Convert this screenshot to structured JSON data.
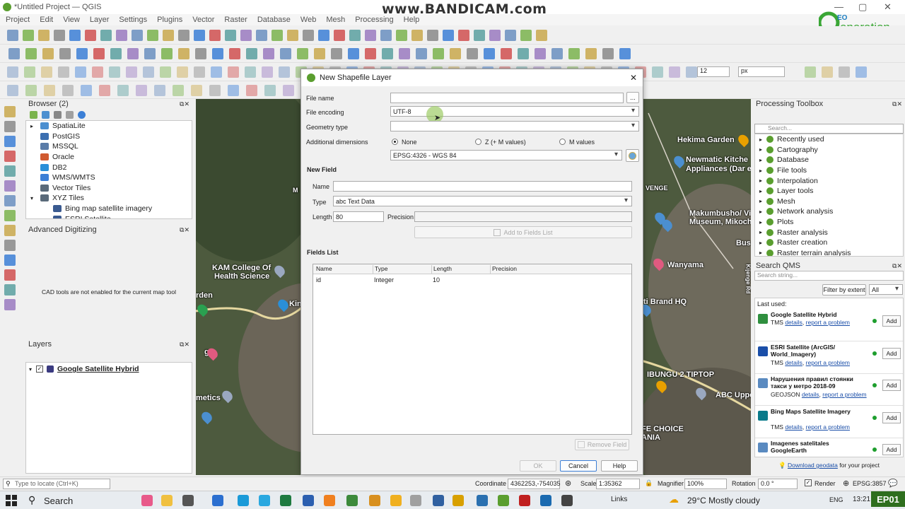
{
  "window": {
    "title": "*Untitled Project — QGIS",
    "watermark": "www.BANDICAM.com"
  },
  "menu": [
    "Project",
    "Edit",
    "View",
    "Layer",
    "Settings",
    "Plugins",
    "Vector",
    "Raster",
    "Database",
    "Web",
    "Mesh",
    "Processing",
    "Help"
  ],
  "logo": {
    "text": "Generation",
    "accent": "#3aa635"
  },
  "toolbar": {
    "symbol_size": "12",
    "unit": "px"
  },
  "browser": {
    "title": "Browser (2)",
    "items": [
      "SpatiaLite",
      "PostGIS",
      "MSSQL",
      "Oracle",
      "DB2",
      "WMS/WMTS",
      "Vector Tiles",
      "XYZ Tiles",
      "Bing map satellite imagery",
      "ESRI Satellite"
    ]
  },
  "digitizing": {
    "title": "Advanced Digitizing",
    "message": "CAD tools are not enabled for the current map tool"
  },
  "layers": {
    "title": "Layers",
    "layer_name": "Google Satellite Hybrid"
  },
  "map_labels": [
    "Hekima Garden",
    "Newmatic Kitche",
    "Appliances (Dar e",
    "Makumbusho/ Villa",
    "Museum, Mikoche",
    "Bus term",
    "Wanyama",
    "KAM College Of",
    "Health Science",
    "ti Brand HQ",
    "IBUNGU 2 TIPTOP",
    "ABC Upper",
    "FE CHOICE",
    "ANIA",
    "rden",
    "Kin",
    "metics",
    "ga",
    "M",
    "VENGE",
    "Kijenge Rd"
  ],
  "dialog": {
    "title": "New Shapefile Layer",
    "file_name_label": "File name",
    "file_name_value": "",
    "browse": "...",
    "encoding_label": "File encoding",
    "encoding_value": "UTF-8",
    "geometry_label": "Geometry type",
    "geometry_value": "",
    "dimensions_label": "Additional dimensions",
    "dim_none": "None",
    "dim_z": "Z (+ M values)",
    "dim_m": "M values",
    "crs_value": "EPSG:4326 - WGS 84",
    "new_field_header": "New Field",
    "name_label": "Name",
    "name_value": "",
    "type_label": "Type",
    "type_value": "abc Text Data",
    "length_label": "Length",
    "length_value": "80",
    "precision_label": "Precision",
    "precision_value": "",
    "add_field": "Add to Fields List",
    "fields_list_header": "Fields List",
    "columns": [
      "Name",
      "Type",
      "Length",
      "Precision"
    ],
    "rows": [
      [
        "id",
        "Integer",
        "10",
        ""
      ]
    ],
    "remove_field": "Remove Field",
    "ok": "OK",
    "cancel": "Cancel",
    "help": "Help"
  },
  "processing": {
    "title": "Processing Toolbox",
    "search_placeholder": "Search...",
    "items": [
      "Recently used",
      "Cartography",
      "Database",
      "File tools",
      "Interpolation",
      "Layer tools",
      "Mesh",
      "Network analysis",
      "Plots",
      "Raster analysis",
      "Raster creation",
      "Raster terrain analysis"
    ]
  },
  "qms": {
    "title": "Search QMS",
    "search_placeholder": "Search string...",
    "filter_label": "Filter by extent",
    "filter_value": "All",
    "last_used": "Last used:",
    "add": "Add",
    "details": "details",
    "report": "report a problem",
    "items": [
      {
        "title": "Google Satellite Hybrid",
        "type": "TMS"
      },
      {
        "title": "ESRI Satellite (ArcGIS/ World_Imagery)",
        "type": "TMS"
      },
      {
        "title": "Нарушения правил стоянки такси у метро 2018-09",
        "type": "GEOJSON"
      },
      {
        "title": "Bing Maps Satellite Imagery",
        "type": "TMS"
      },
      {
        "title": "Imagenes satelitales GoogleEarth",
        "type": ""
      }
    ],
    "download_link": "Download geodata",
    "download_suffix": "for your project"
  },
  "status": {
    "locate_placeholder": "Type to locate (Ctrl+K)",
    "coordinate_label": "Coordinate",
    "coordinate_value": "4362253,-754035",
    "scale_label": "Scale",
    "scale_value": "1:35362",
    "magnifier_label": "Magnifier",
    "magnifier_value": "100%",
    "rotation_label": "Rotation",
    "rotation_value": "0.0 °",
    "render_label": "Render",
    "crs": "EPSG:3857"
  },
  "taskbar": {
    "search": "Search",
    "links": "Links",
    "weather": "29°C  Mostly cloudy",
    "lang": "ENG",
    "time": "13:21",
    "badge": "EP01"
  }
}
